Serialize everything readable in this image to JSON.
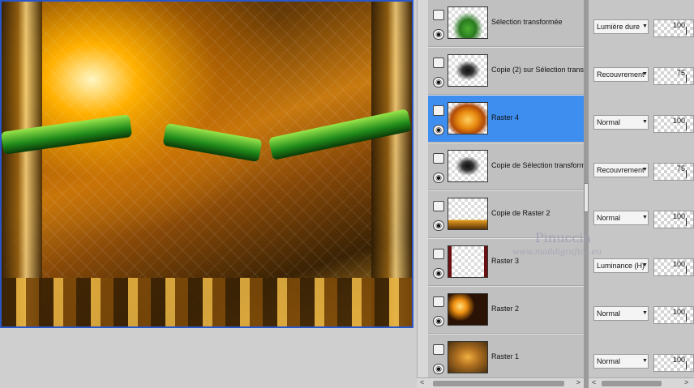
{
  "layers": [
    {
      "name": "Sélection transformée",
      "blend": "Lumière dure",
      "opacity": "100",
      "thumb": "green-shape",
      "selected": false
    },
    {
      "name": "Copie (2) sur Sélection trans",
      "blend": "Recouvrement",
      "opacity": "75",
      "thumb": "dark-shape",
      "selected": false
    },
    {
      "name": "Raster 4",
      "blend": "Normal",
      "opacity": "100",
      "thumb": "orange-blob",
      "selected": true
    },
    {
      "name": "Copie de Sélection transform",
      "blend": "Recouvrement",
      "opacity": "75",
      "thumb": "dark-shape",
      "selected": false
    },
    {
      "name": "Copie de Raster 2",
      "blend": "Normal",
      "opacity": "100",
      "thumb": "transparent-strip",
      "selected": false
    },
    {
      "name": "Raster 3",
      "blend": "Luminance (H)",
      "opacity": "100",
      "thumb": "side-bars",
      "selected": false
    },
    {
      "name": "Raster 2",
      "blend": "Normal",
      "opacity": "100",
      "thumb": "orange-flowers",
      "selected": false
    },
    {
      "name": "Raster 1",
      "blend": "Normal",
      "opacity": "100",
      "thumb": "gold-gradient",
      "selected": false
    }
  ],
  "watermark": {
    "line1": "Pinuccia",
    "line2": "www.maildigrafica.eu"
  },
  "colors": {
    "selection": "#3e8ef0",
    "canvas_border": "#2a56c6"
  },
  "icons": {
    "visibility": "eye-icon",
    "layer_type": "raster-layer-icon",
    "blend_dropdown": "chevron-down-icon"
  }
}
